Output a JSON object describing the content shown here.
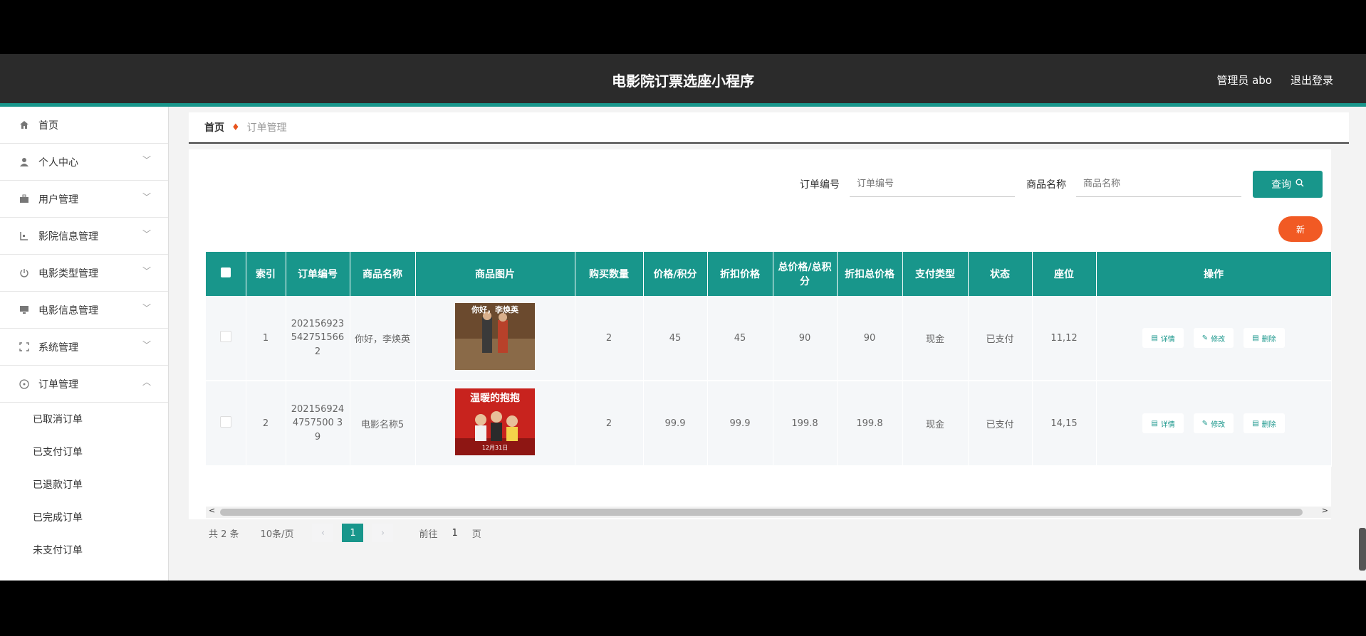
{
  "header": {
    "title": "电影院订票选座小程序",
    "admin": "管理员 abo",
    "logout": "退出登录"
  },
  "sidebar": {
    "items": [
      {
        "label": "首页",
        "icon": "home-icon",
        "chev": ""
      },
      {
        "label": "个人中心",
        "icon": "user-icon",
        "chev": "﹀"
      },
      {
        "label": "用户管理",
        "icon": "briefcase-icon",
        "chev": "﹀"
      },
      {
        "label": "影院信息管理",
        "icon": "building-icon",
        "chev": "﹀"
      },
      {
        "label": "电影类型管理",
        "icon": "power-icon",
        "chev": "﹀"
      },
      {
        "label": "电影信息管理",
        "icon": "monitor-icon",
        "chev": "﹀"
      },
      {
        "label": "系统管理",
        "icon": "frame-icon",
        "chev": "﹀"
      },
      {
        "label": "订单管理",
        "icon": "compass-icon",
        "chev": "︿"
      }
    ],
    "subitems": [
      "已取消订单",
      "已支付订单",
      "已退款订单",
      "已完成订单",
      "未支付订单"
    ]
  },
  "breadcrumb": {
    "home": "首页",
    "current": "订单管理"
  },
  "search": {
    "order_label": "订单编号",
    "order_placeholder": "订单编号",
    "product_label": "商品名称",
    "product_placeholder": "商品名称",
    "query_button": "查询",
    "add_button": "新"
  },
  "table": {
    "headers": [
      "索引",
      "订单编号",
      "商品名称",
      "商品图片",
      "购买数量",
      "价格/积分",
      "折扣价格",
      "总价格/总积分",
      "折扣总价格",
      "支付类型",
      "状态",
      "座位",
      "操作"
    ],
    "rows": [
      {
        "index": "1",
        "order_no": "2021569235427515662",
        "product": "你好，李焕英",
        "poster_text": "你好，李焕英",
        "qty": "2",
        "price": "45",
        "discount": "45",
        "total": "90",
        "discount_total": "90",
        "pay_type": "现金",
        "status": "已支付",
        "seat": "11,12"
      },
      {
        "index": "2",
        "order_no": "2021569244757500 39",
        "product": "电影名称5",
        "poster_text": "温暖的抱抱",
        "poster_date": "12月31日",
        "qty": "2",
        "price": "99.9",
        "discount": "99.9",
        "total": "199.8",
        "discount_total": "199.8",
        "pay_type": "现金",
        "status": "已支付",
        "seat": "14,15"
      }
    ],
    "actions": {
      "detail": "详情",
      "edit": "修改",
      "delete": "删除"
    }
  },
  "pager": {
    "total": "共 2 条",
    "page_size": "10条/页",
    "current": "1",
    "goto_label": "前往",
    "goto_value": "1",
    "page_unit": "页"
  },
  "colors": {
    "accent": "#18968b",
    "header_bg": "#2b2b2b",
    "add_button": "#f15a24"
  }
}
